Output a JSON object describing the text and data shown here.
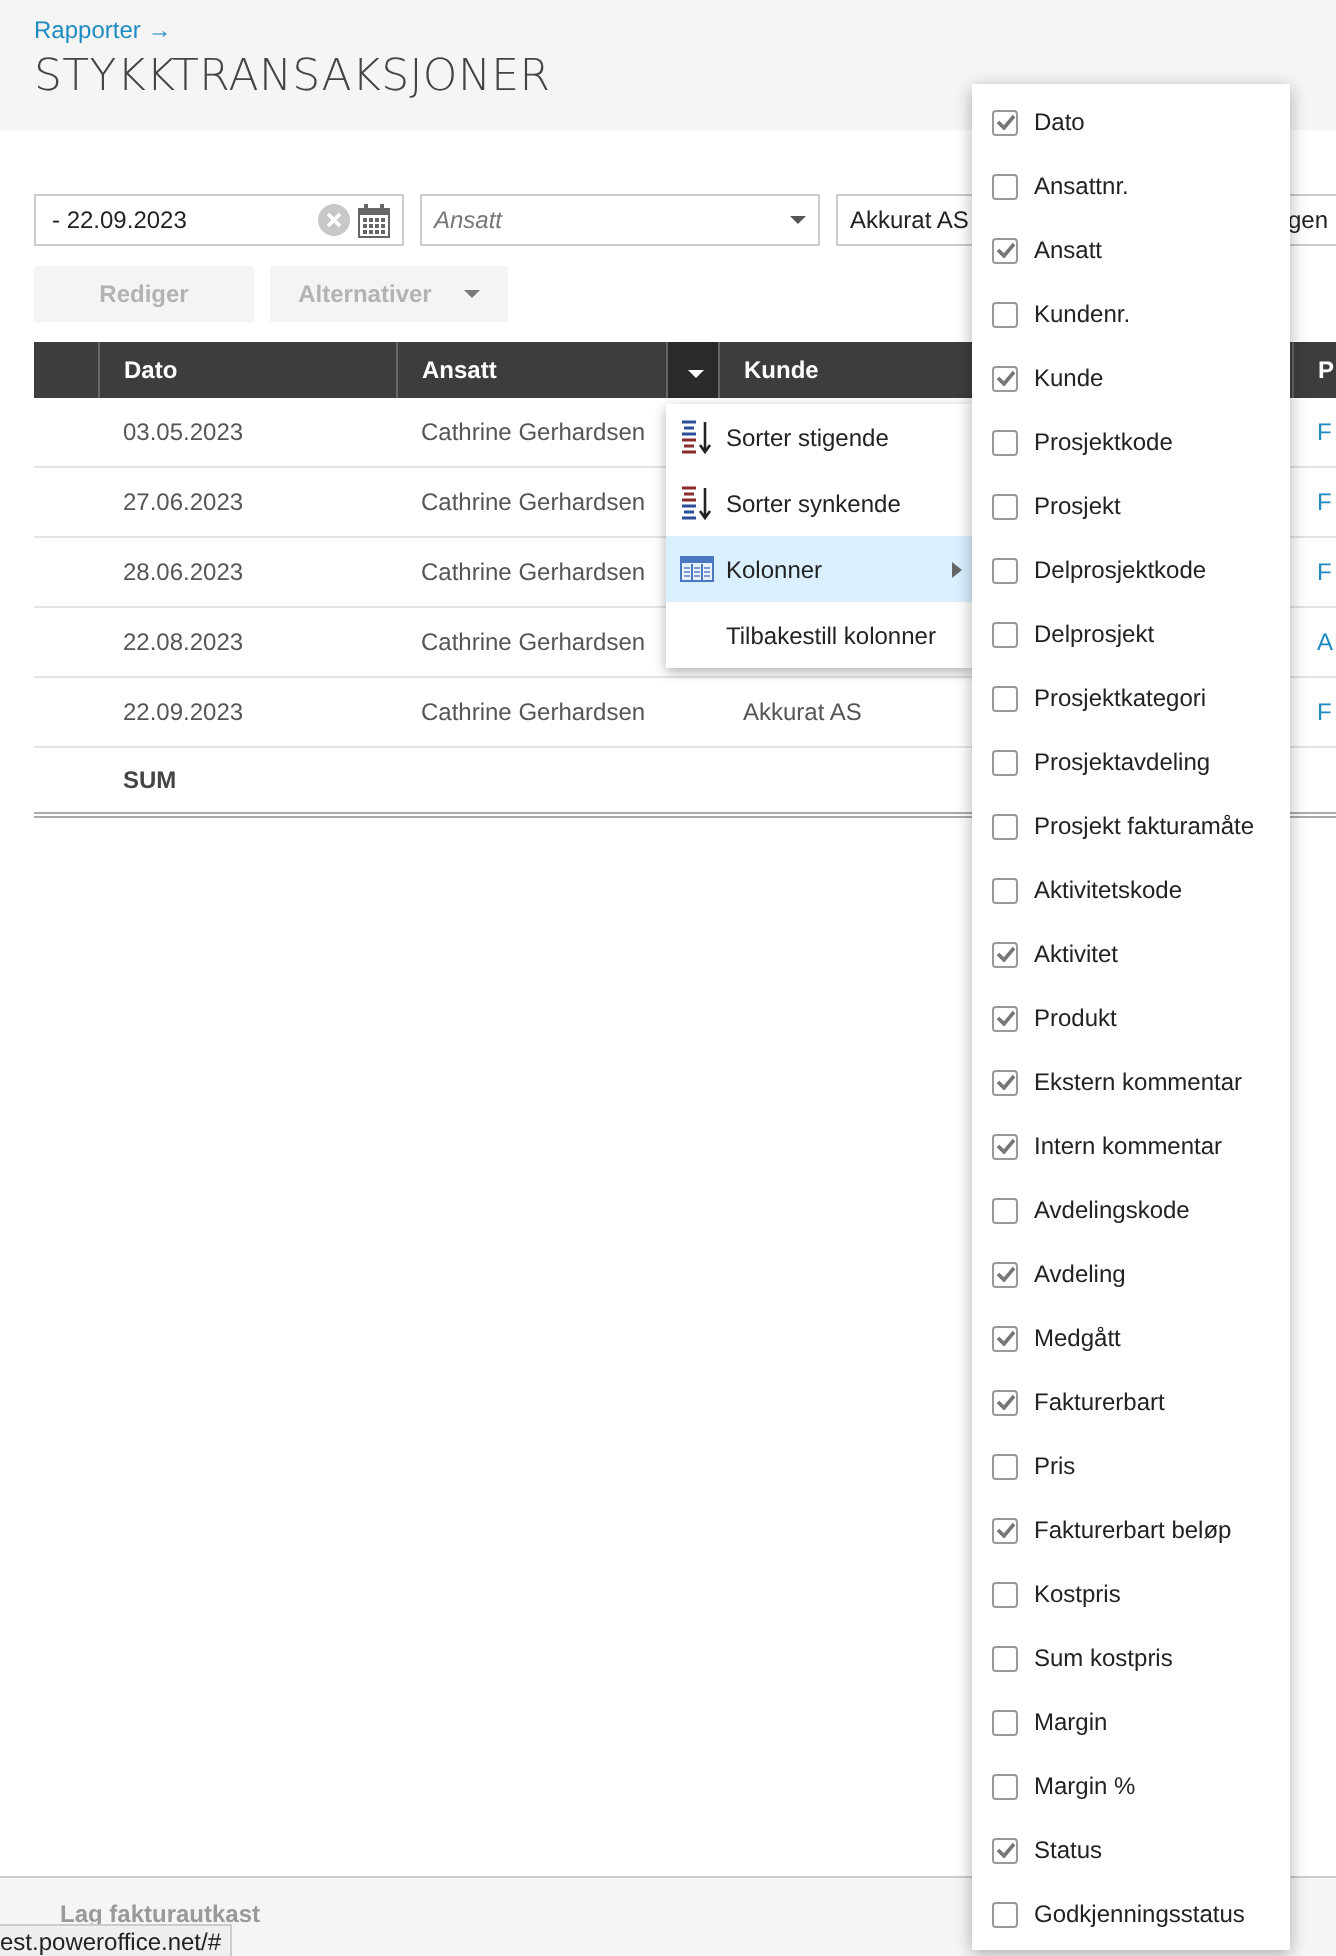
{
  "breadcrumb": "Rapporter →",
  "title": "STYKKTRANSAKSJONER",
  "filters": {
    "date": "- 22.09.2023",
    "employee_placeholder": "Ansatt",
    "customer": "Akkurat AS",
    "field_4": "gen"
  },
  "buttons": [
    {
      "label": "Rediger",
      "dropdown": false,
      "disabled": true
    },
    {
      "label": "Alternativer",
      "dropdown": true,
      "disabled": true
    }
  ],
  "table": {
    "columns": [
      "Dato",
      "Ansatt",
      "Kunde",
      "P"
    ],
    "rows": [
      {
        "dato": "03.05.2023",
        "ansatt": "Cathrine Gerhardsen",
        "column_4": "F"
      },
      {
        "dato": "27.06.2023",
        "ansatt": "Cathrine Gerhardsen",
        "column_4": "F"
      },
      {
        "dato": "28.06.2023",
        "ansatt": "Cathrine Gerhardsen",
        "column_4": "F"
      },
      {
        "dato": "22.08.2023",
        "ansatt": "Cathrine Gerhardsen",
        "column_4": "A"
      },
      {
        "dato": "22.09.2023",
        "ansatt": "Cathrine Gerhardsen",
        "kunde": "Akkurat AS",
        "column_4": "F"
      }
    ],
    "sum_label": "SUM"
  },
  "column_menu": [
    {
      "kind": "sort-asc",
      "label": "Sorter stigende",
      "highlighted": false
    },
    {
      "kind": "sort-desc",
      "label": "Sorter synkende",
      "highlighted": false
    },
    {
      "kind": "columns",
      "label": "Kolonner",
      "highlighted": true
    },
    {
      "kind": "reset",
      "label": "Tilbakestill kolonner",
      "highlighted": false
    }
  ],
  "columns_submenu": [
    {
      "label": "Dato",
      "checked": true
    },
    {
      "label": "Ansattnr.",
      "checked": false
    },
    {
      "label": "Ansatt",
      "checked": true
    },
    {
      "label": "Kundenr.",
      "checked": false
    },
    {
      "label": "Kunde",
      "checked": true
    },
    {
      "label": "Prosjektkode",
      "checked": false
    },
    {
      "label": "Prosjekt",
      "checked": false
    },
    {
      "label": "Delprosjektkode",
      "checked": false
    },
    {
      "label": "Delprosjekt",
      "checked": false
    },
    {
      "label": "Prosjektkategori",
      "checked": false
    },
    {
      "label": "Prosjektavdeling",
      "checked": false
    },
    {
      "label": "Prosjekt fakturamåte",
      "checked": false
    },
    {
      "label": "Aktivitetskode",
      "checked": false
    },
    {
      "label": "Aktivitet",
      "checked": true
    },
    {
      "label": "Produkt",
      "checked": true
    },
    {
      "label": "Ekstern kommentar",
      "checked": true
    },
    {
      "label": "Intern kommentar",
      "checked": true
    },
    {
      "label": "Avdelingskode",
      "checked": false
    },
    {
      "label": "Avdeling",
      "checked": true
    },
    {
      "label": "Medgått",
      "checked": true
    },
    {
      "label": "Fakturerbart",
      "checked": true
    },
    {
      "label": "Pris",
      "checked": false
    },
    {
      "label": "Fakturerbart beløp",
      "checked": true
    },
    {
      "label": "Kostpris",
      "checked": false
    },
    {
      "label": "Sum kostpris",
      "checked": false
    },
    {
      "label": "Margin",
      "checked": false
    },
    {
      "label": "Margin %",
      "checked": false
    },
    {
      "label": "Status",
      "checked": true
    },
    {
      "label": "Godkjenningsstatus",
      "checked": false
    }
  ],
  "footer": {
    "button": "Lag fakturautkast"
  },
  "status_bar": "est.poweroffice.net/#"
}
